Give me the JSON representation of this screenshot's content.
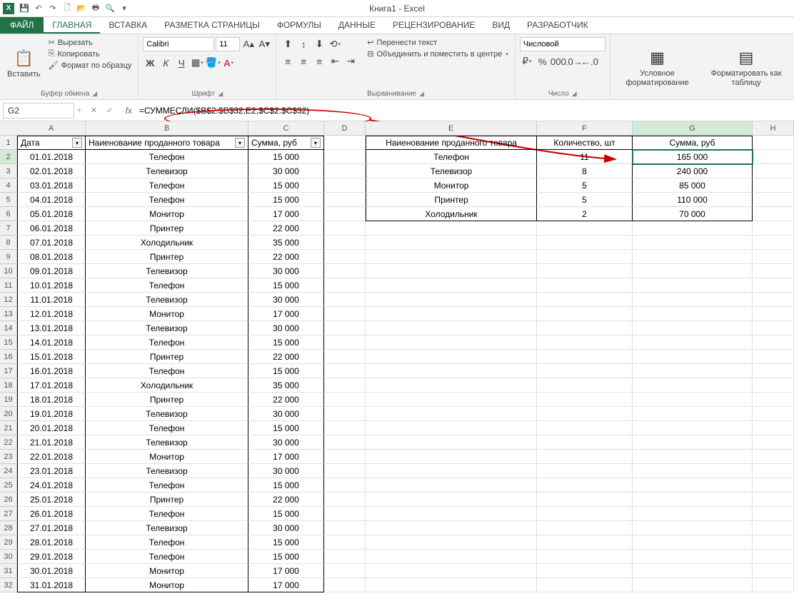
{
  "app": {
    "title": "Книга1 - Excel",
    "app_short": "X"
  },
  "qat": [
    "save-icon",
    "undo-icon",
    "redo-icon",
    "new-icon",
    "open-icon",
    "quickprint-icon",
    "preview-icon",
    "spell-icon",
    "sort-icon"
  ],
  "tabs": {
    "file": "ФАЙЛ",
    "items": [
      "ГЛАВНАЯ",
      "ВСТАВКА",
      "РАЗМЕТКА СТРАНИЦЫ",
      "ФОРМУЛЫ",
      "ДАННЫЕ",
      "РЕЦЕНЗИРОВАНИЕ",
      "ВИД",
      "РАЗРАБОТЧИК"
    ],
    "active": 0
  },
  "ribbon": {
    "clipboard": {
      "paste": "Вставить",
      "cut": "Вырезать",
      "copy": "Копировать",
      "painter": "Формат по образцу",
      "label": "Буфер обмена"
    },
    "font": {
      "name": "Calibri",
      "size": "11",
      "bold": "Ж",
      "italic": "К",
      "underline": "Ч",
      "label": "Шрифт"
    },
    "align": {
      "wrap": "Перенести текст",
      "merge": "Объединить и поместить в центре",
      "label": "Выравнивание"
    },
    "number": {
      "format": "Числовой",
      "label": "Число"
    },
    "styles": {
      "cond": "Условное форматирование",
      "table": "Форматировать как таблицу",
      "label": ""
    }
  },
  "formula": {
    "cell_ref": "G2",
    "text": "=СУММЕСЛИ($B$2:$B$32;E2;$C$2:$C$32)"
  },
  "columns": [
    "A",
    "B",
    "C",
    "D",
    "E",
    "F",
    "G",
    "H"
  ],
  "header_row": {
    "A": "Дата",
    "B": "Наиенование проданного товара",
    "C": "Сумма, руб",
    "E": "Наиенование проданного товара",
    "F": "Количество, шт",
    "G": "Сумма, руб"
  },
  "left_table": [
    {
      "d": "01.01.2018",
      "n": "Телефон",
      "s": "15 000"
    },
    {
      "d": "02.01.2018",
      "n": "Телевизор",
      "s": "30 000"
    },
    {
      "d": "03.01.2018",
      "n": "Телефон",
      "s": "15 000"
    },
    {
      "d": "04.01.2018",
      "n": "Телефон",
      "s": "15 000"
    },
    {
      "d": "05.01.2018",
      "n": "Монитор",
      "s": "17 000"
    },
    {
      "d": "06.01.2018",
      "n": "Принтер",
      "s": "22 000"
    },
    {
      "d": "07.01.2018",
      "n": "Холодильник",
      "s": "35 000"
    },
    {
      "d": "08.01.2018",
      "n": "Принтер",
      "s": "22 000"
    },
    {
      "d": "09.01.2018",
      "n": "Телевизор",
      "s": "30 000"
    },
    {
      "d": "10.01.2018",
      "n": "Телефон",
      "s": "15 000"
    },
    {
      "d": "11.01.2018",
      "n": "Телевизор",
      "s": "30 000"
    },
    {
      "d": "12.01.2018",
      "n": "Монитор",
      "s": "17 000"
    },
    {
      "d": "13.01.2018",
      "n": "Телевизор",
      "s": "30 000"
    },
    {
      "d": "14.01.2018",
      "n": "Телефон",
      "s": "15 000"
    },
    {
      "d": "15.01.2018",
      "n": "Принтер",
      "s": "22 000"
    },
    {
      "d": "16.01.2018",
      "n": "Телефон",
      "s": "15 000"
    },
    {
      "d": "17.01.2018",
      "n": "Холодильник",
      "s": "35 000"
    },
    {
      "d": "18.01.2018",
      "n": "Принтер",
      "s": "22 000"
    },
    {
      "d": "19.01.2018",
      "n": "Телевизор",
      "s": "30 000"
    },
    {
      "d": "20.01.2018",
      "n": "Телефон",
      "s": "15 000"
    },
    {
      "d": "21.01.2018",
      "n": "Телевизор",
      "s": "30 000"
    },
    {
      "d": "22.01.2018",
      "n": "Монитор",
      "s": "17 000"
    },
    {
      "d": "23.01.2018",
      "n": "Телевизор",
      "s": "30 000"
    },
    {
      "d": "24.01.2018",
      "n": "Телефон",
      "s": "15 000"
    },
    {
      "d": "25.01.2018",
      "n": "Принтер",
      "s": "22 000"
    },
    {
      "d": "26.01.2018",
      "n": "Телефон",
      "s": "15 000"
    },
    {
      "d": "27.01.2018",
      "n": "Телевизор",
      "s": "30 000"
    },
    {
      "d": "28.01.2018",
      "n": "Телефон",
      "s": "15 000"
    },
    {
      "d": "29.01.2018",
      "n": "Телефон",
      "s": "15 000"
    },
    {
      "d": "30.01.2018",
      "n": "Монитор",
      "s": "17 000"
    },
    {
      "d": "31.01.2018",
      "n": "Монитор",
      "s": "17 000"
    }
  ],
  "right_table": [
    {
      "n": "Телефон",
      "q": "11",
      "s": "165 000"
    },
    {
      "n": "Телевизор",
      "q": "8",
      "s": "240 000"
    },
    {
      "n": "Монитор",
      "q": "5",
      "s": "85 000"
    },
    {
      "n": "Принтер",
      "q": "5",
      "s": "110 000"
    },
    {
      "n": "Холодильник",
      "q": "2",
      "s": "70 000"
    }
  ],
  "selected_cell": "G2"
}
